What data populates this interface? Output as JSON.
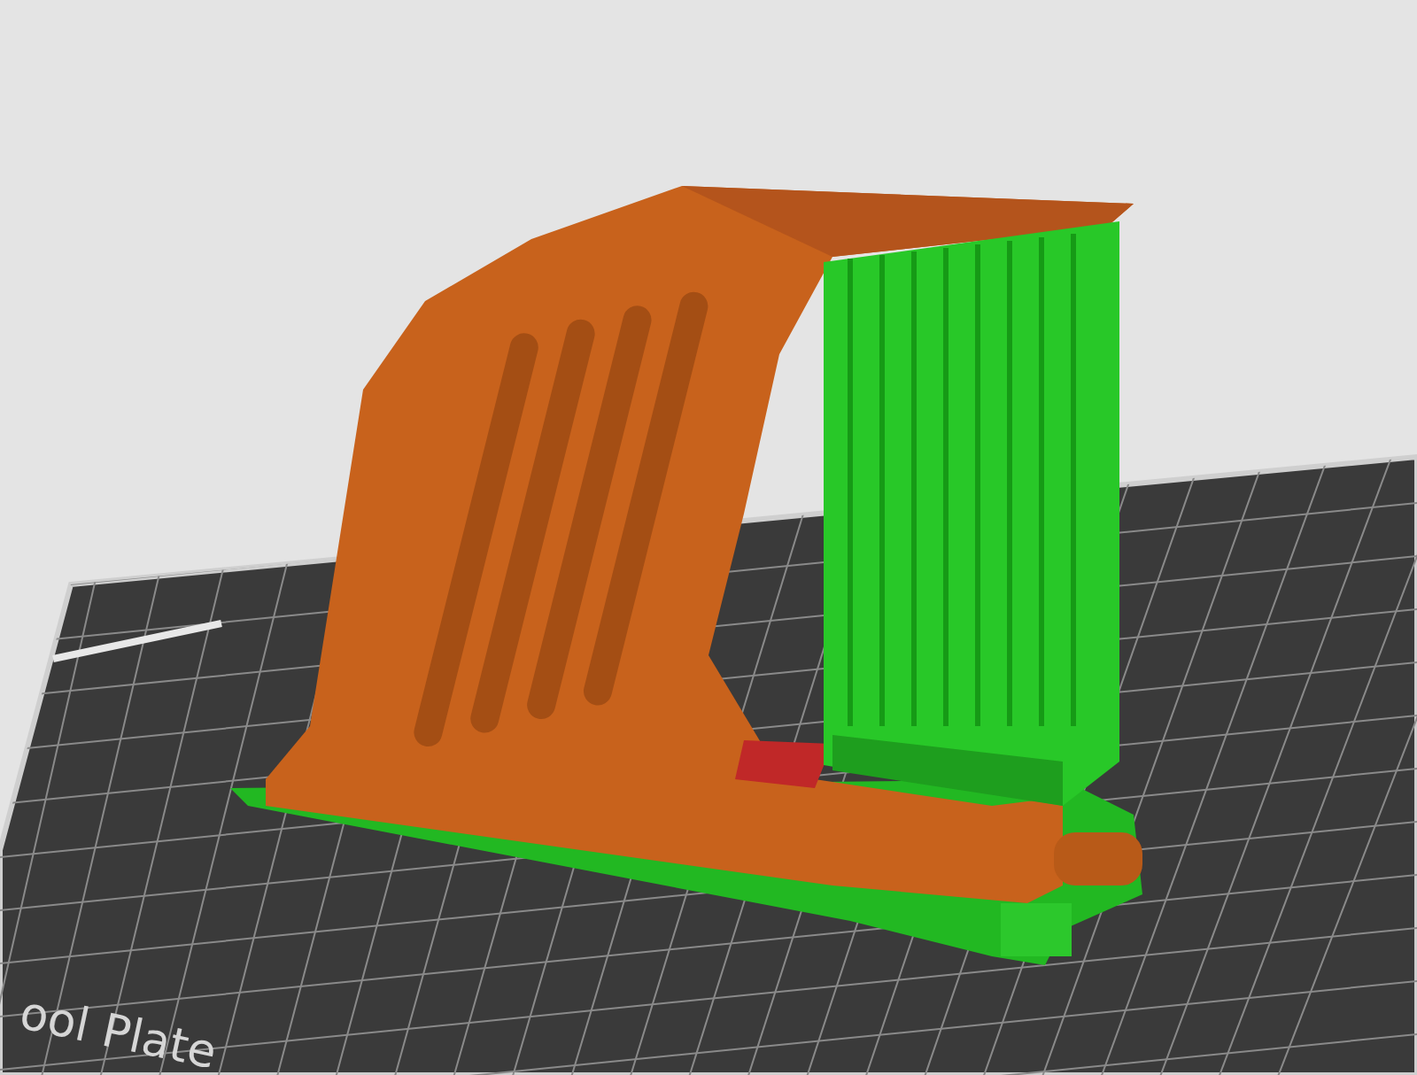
{
  "bed": {
    "label": "ool Plate"
  }
}
